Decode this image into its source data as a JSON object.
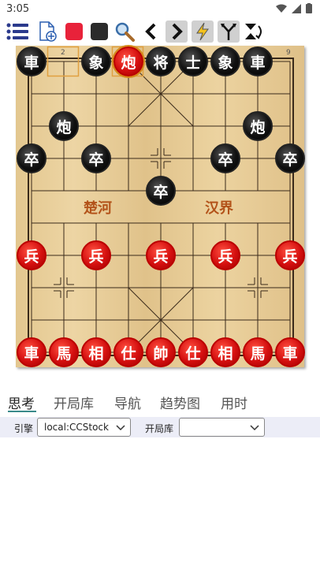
{
  "status": {
    "time": "3:05"
  },
  "toolbar": {
    "buttons": [
      {
        "name": "menu-icon"
      },
      {
        "name": "new-document-icon"
      },
      {
        "name": "red-square-icon",
        "color": "#e8223a"
      },
      {
        "name": "black-square-icon",
        "color": "#2b2b2b"
      },
      {
        "name": "search-icon"
      },
      {
        "name": "chevron-left-icon"
      },
      {
        "name": "chevron-right-icon"
      },
      {
        "name": "lightning-icon"
      },
      {
        "name": "branch-icon"
      },
      {
        "name": "flip-icon"
      }
    ]
  },
  "board": {
    "file_labels_top": [
      "2",
      "9"
    ],
    "river": {
      "left": "楚河",
      "right": "汉界"
    },
    "pieces": [
      {
        "char": "車",
        "side": "black",
        "col": 0,
        "row": 0
      },
      {
        "char": "象",
        "side": "black",
        "col": 2,
        "row": 0
      },
      {
        "char": "炮",
        "side": "red",
        "col": 3,
        "row": 0,
        "selected": true
      },
      {
        "char": "将",
        "side": "black",
        "col": 4,
        "row": 0
      },
      {
        "char": "士",
        "side": "black",
        "col": 5,
        "row": 0
      },
      {
        "char": "象",
        "side": "black",
        "col": 6,
        "row": 0
      },
      {
        "char": "車",
        "side": "black",
        "col": 7,
        "row": 0
      },
      {
        "char": "炮",
        "side": "black",
        "col": 1,
        "row": 2
      },
      {
        "char": "炮",
        "side": "black",
        "col": 7,
        "row": 2
      },
      {
        "char": "卒",
        "side": "black",
        "col": 0,
        "row": 3
      },
      {
        "char": "卒",
        "side": "black",
        "col": 2,
        "row": 3
      },
      {
        "char": "卒",
        "side": "black",
        "col": 6,
        "row": 3
      },
      {
        "char": "卒",
        "side": "black",
        "col": 8,
        "row": 3
      },
      {
        "char": "卒",
        "side": "black",
        "col": 4,
        "row": 4
      },
      {
        "char": "兵",
        "side": "red",
        "col": 0,
        "row": 6
      },
      {
        "char": "兵",
        "side": "red",
        "col": 2,
        "row": 6
      },
      {
        "char": "兵",
        "side": "red",
        "col": 4,
        "row": 6
      },
      {
        "char": "兵",
        "side": "red",
        "col": 6,
        "row": 6
      },
      {
        "char": "兵",
        "side": "red",
        "col": 8,
        "row": 6
      },
      {
        "char": "車",
        "side": "red",
        "col": 0,
        "row": 9
      },
      {
        "char": "馬",
        "side": "red",
        "col": 1,
        "row": 9
      },
      {
        "char": "相",
        "side": "red",
        "col": 2,
        "row": 9
      },
      {
        "char": "仕",
        "side": "red",
        "col": 3,
        "row": 9
      },
      {
        "char": "帥",
        "side": "red",
        "col": 4,
        "row": 9
      },
      {
        "char": "仕",
        "side": "red",
        "col": 5,
        "row": 9
      },
      {
        "char": "相",
        "side": "red",
        "col": 6,
        "row": 9
      },
      {
        "char": "馬",
        "side": "red",
        "col": 7,
        "row": 9
      },
      {
        "char": "車",
        "side": "red",
        "col": 8,
        "row": 9
      }
    ]
  },
  "tabs": [
    "思考",
    "开局库",
    "导航",
    "趋势图",
    "用时"
  ],
  "engine_panel": {
    "engine_label": "引擎",
    "engine_value": "local:CCStock",
    "book_label": "开局库",
    "book_value": ""
  }
}
